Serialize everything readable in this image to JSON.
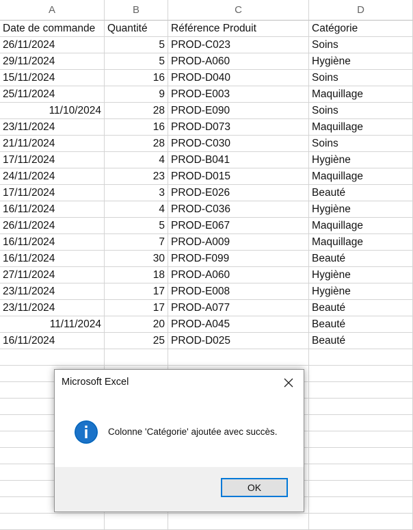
{
  "columns": [
    "A",
    "B",
    "C",
    "D"
  ],
  "headers": [
    "Date de commande",
    "Quantité",
    "Référence Produit",
    "Catégorie"
  ],
  "rows": [
    {
      "date": "26/11/2024",
      "qty": "5",
      "ref": "PROD-C023",
      "cat": "Soins",
      "date_align": "left"
    },
    {
      "date": "29/11/2024",
      "qty": "5",
      "ref": "PROD-A060",
      "cat": "Hygiène",
      "date_align": "left"
    },
    {
      "date": "15/11/2024",
      "qty": "16",
      "ref": "PROD-D040",
      "cat": "Soins",
      "date_align": "left"
    },
    {
      "date": "25/11/2024",
      "qty": "9",
      "ref": "PROD-E003",
      "cat": "Maquillage",
      "date_align": "left"
    },
    {
      "date": "11/10/2024",
      "qty": "28",
      "ref": "PROD-E090",
      "cat": "Soins",
      "date_align": "right"
    },
    {
      "date": "23/11/2024",
      "qty": "16",
      "ref": "PROD-D073",
      "cat": "Maquillage",
      "date_align": "left"
    },
    {
      "date": "21/11/2024",
      "qty": "28",
      "ref": "PROD-C030",
      "cat": "Soins",
      "date_align": "left"
    },
    {
      "date": "17/11/2024",
      "qty": "4",
      "ref": "PROD-B041",
      "cat": "Hygiène",
      "date_align": "left"
    },
    {
      "date": "24/11/2024",
      "qty": "23",
      "ref": "PROD-D015",
      "cat": "Maquillage",
      "date_align": "left"
    },
    {
      "date": "17/11/2024",
      "qty": "3",
      "ref": "PROD-E026",
      "cat": "Beauté",
      "date_align": "left"
    },
    {
      "date": "16/11/2024",
      "qty": "4",
      "ref": "PROD-C036",
      "cat": "Hygiène",
      "date_align": "left"
    },
    {
      "date": "26/11/2024",
      "qty": "5",
      "ref": "PROD-E067",
      "cat": "Maquillage",
      "date_align": "left"
    },
    {
      "date": "16/11/2024",
      "qty": "7",
      "ref": "PROD-A009",
      "cat": "Maquillage",
      "date_align": "left"
    },
    {
      "date": "16/11/2024",
      "qty": "30",
      "ref": "PROD-F099",
      "cat": "Beauté",
      "date_align": "left"
    },
    {
      "date": "27/11/2024",
      "qty": "18",
      "ref": "PROD-A060",
      "cat": "Hygiène",
      "date_align": "left"
    },
    {
      "date": "23/11/2024",
      "qty": "17",
      "ref": "PROD-E008",
      "cat": "Hygiène",
      "date_align": "left"
    },
    {
      "date": "23/11/2024",
      "qty": "17",
      "ref": "PROD-A077",
      "cat": "Beauté",
      "date_align": "left"
    },
    {
      "date": "11/11/2024",
      "qty": "20",
      "ref": "PROD-A045",
      "cat": "Beauté",
      "date_align": "right"
    },
    {
      "date": "16/11/2024",
      "qty": "25",
      "ref": "PROD-D025",
      "cat": "Beauté",
      "date_align": "left"
    }
  ],
  "dialog": {
    "title": "Microsoft Excel",
    "icon": "info-icon",
    "message": "Colonne 'Catégorie' ajoutée avec succès.",
    "ok_label": "OK"
  },
  "colors": {
    "accent": "#0078d7",
    "grid": "#d4d4d4",
    "dialog_footer": "#f0f0f0"
  }
}
